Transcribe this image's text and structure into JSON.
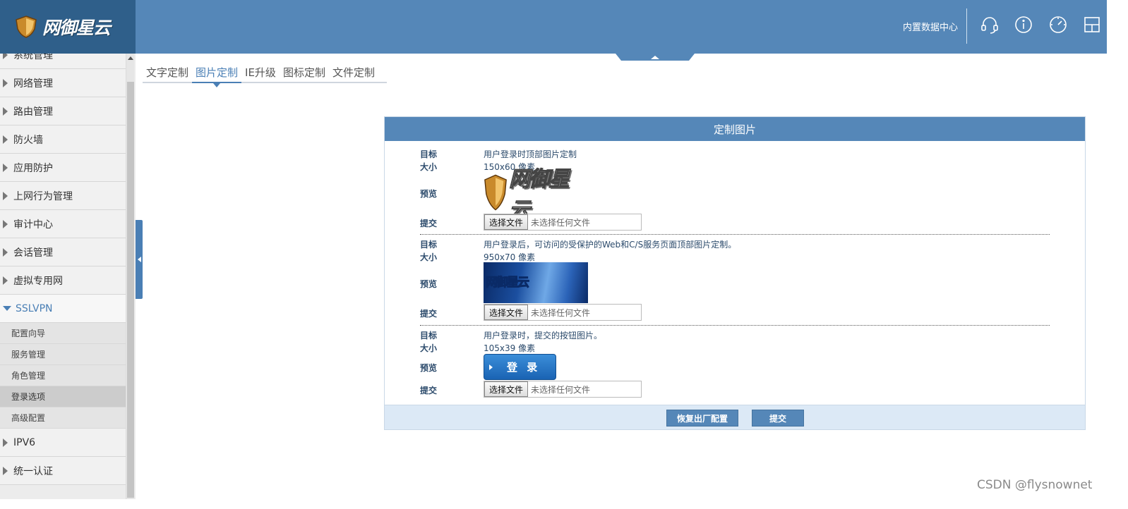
{
  "app": {
    "logo_text": "网御星云",
    "datacenter_label": "内置数据中心",
    "icons": [
      "headset-icon",
      "info-icon",
      "dashboard-icon",
      "layout-icon"
    ]
  },
  "sidebar": {
    "items": [
      {
        "label": "系统管理"
      },
      {
        "label": "网络管理"
      },
      {
        "label": "路由管理"
      },
      {
        "label": "防火墙"
      },
      {
        "label": "应用防护"
      },
      {
        "label": "上网行为管理"
      },
      {
        "label": "审计中心"
      },
      {
        "label": "会话管理"
      },
      {
        "label": "虚拟专用网"
      },
      {
        "label": "SSLVPN"
      },
      {
        "label": "IPV6"
      },
      {
        "label": "统一认证"
      }
    ],
    "sslvpn_sub": [
      {
        "label": "配置向导"
      },
      {
        "label": "服务管理"
      },
      {
        "label": "角色管理"
      },
      {
        "label": "登录选项"
      },
      {
        "label": "高级配置"
      }
    ]
  },
  "tabs": [
    {
      "label": "文字定制"
    },
    {
      "label": "图片定制"
    },
    {
      "label": "IE升级"
    },
    {
      "label": "图标定制"
    },
    {
      "label": "文件定制"
    }
  ],
  "panel": {
    "title": "定制图片",
    "labels": {
      "target": "目标",
      "size": "大小",
      "preview": "预览",
      "submit": "提交"
    },
    "file_button": "选择文件",
    "file_status": "未选择任何文件",
    "blocks": [
      {
        "target": "用户登录时顶部图片定制",
        "size": "150x60 像素",
        "preview_text": "网御星云"
      },
      {
        "target": "用户登录后，可访问的受保护的Web和C/S服务页面顶部图片定制。",
        "size": "950x70 像素",
        "preview_text": "网御星云"
      },
      {
        "target": "用户登录时，提交的按钮图片。",
        "size": "105x39 像素",
        "preview_text": "登 录"
      }
    ],
    "buttons": {
      "restore": "恢复出厂配置",
      "submit": "提交"
    }
  },
  "watermark": "CSDN @flysnownet",
  "colors": {
    "brand": "#5587b8",
    "logo_bg": "#2f5f8a",
    "footer_bg": "#dce9f6"
  }
}
